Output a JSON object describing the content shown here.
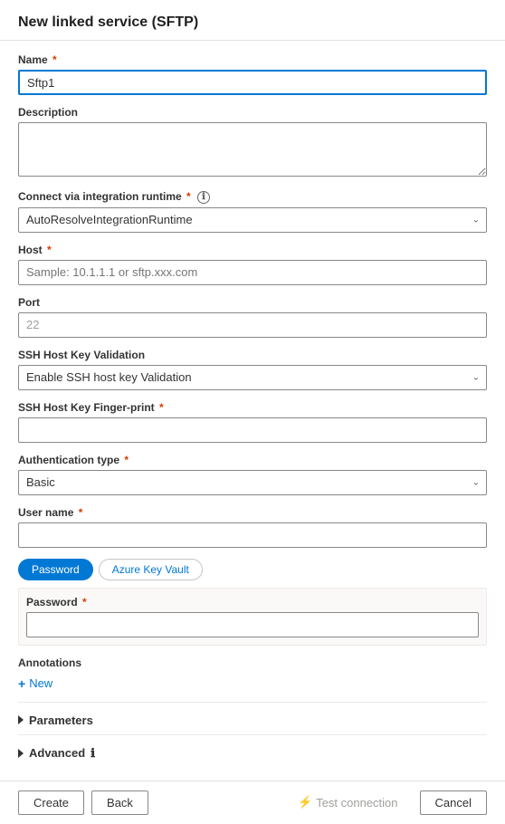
{
  "header": {
    "title": "New linked service (SFTP)"
  },
  "form": {
    "name_label": "Name",
    "name_value": "Sftp1",
    "description_label": "Description",
    "description_placeholder": "",
    "runtime_label": "Connect via integration runtime",
    "runtime_value": "AutoResolveIntegrationRuntime",
    "host_label": "Host",
    "host_placeholder": "Sample: 10.1.1.1 or sftp.xxx.com",
    "port_label": "Port",
    "port_value": "22",
    "ssh_validation_label": "SSH Host Key Validation",
    "ssh_validation_value": "Enable SSH host key Validation",
    "ssh_fingerprint_label": "SSH Host Key Finger-print",
    "auth_type_label": "Authentication type",
    "auth_type_value": "Basic",
    "username_label": "User name",
    "password_tab": "Password",
    "azure_vault_tab": "Azure Key Vault",
    "password_label": "Password",
    "annotations_label": "Annotations",
    "add_new_label": "New",
    "parameters_label": "Parameters",
    "advanced_label": "Advanced"
  },
  "footer": {
    "create_label": "Create",
    "back_label": "Back",
    "test_connection_label": "Test connection",
    "cancel_label": "Cancel"
  },
  "icons": {
    "info": "ℹ",
    "chevron_down": "∨",
    "plus": "+",
    "test_icon": "⚡"
  }
}
